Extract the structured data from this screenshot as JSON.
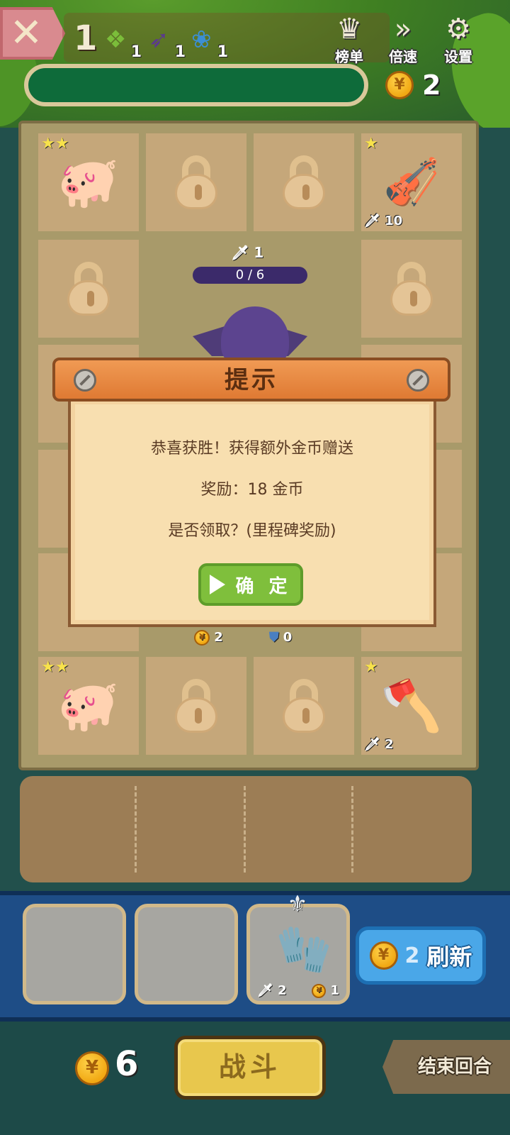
{
  "top_bar": {
    "close_label": "✕",
    "level": "1",
    "resources": [
      {
        "icon": "green-rune-icon",
        "glyph": "❖",
        "count": "1"
      },
      {
        "icon": "purple-wing-icon",
        "glyph": "➶",
        "count": "1"
      },
      {
        "icon": "blue-flower-icon",
        "glyph": "❀",
        "count": "1"
      }
    ],
    "buttons": [
      {
        "name": "leaderboard",
        "label": "榜单",
        "icon": "crown-icon",
        "glyph": "♛"
      },
      {
        "name": "speed",
        "label": "倍速",
        "icon": "fast-forward-icon",
        "glyph": "»"
      },
      {
        "name": "settings",
        "label": "设置",
        "icon": "gear-icon",
        "glyph": "⚙"
      }
    ],
    "coins": "2"
  },
  "board": {
    "cells": [
      {
        "icon": "piggy-bank-icon",
        "stars": "★★"
      },
      {
        "icon": "lock-icon"
      },
      {
        "icon": "lock-icon"
      },
      {
        "icon": "guzheng-icon",
        "stars": "★",
        "attack": "10"
      },
      {
        "icon": "lock-icon"
      },
      {
        "icon": "lock-icon"
      },
      {
        "icon": "piggy-bank-icon",
        "stars": "★★"
      },
      {
        "icon": "lock-icon"
      },
      {
        "icon": "lock-icon"
      },
      {
        "icon": "battle-axe-icon",
        "stars": "★",
        "attack": "2"
      }
    ],
    "enemy": {
      "attack": "1",
      "progress_text": "0 / 6",
      "gold": "2",
      "shield": "0"
    }
  },
  "modal": {
    "title": "提示",
    "line1": "恭喜获胜！获得额外金币赠送",
    "line2": "奖励：18 金币",
    "line3": "是否领取？(里程碑奖励)",
    "confirm_label": "确 定"
  },
  "shop": {
    "slots": [
      {
        "empty": true
      },
      {
        "empty": true
      },
      {
        "icon": "claw-gauntlet-icon",
        "attack": "2",
        "cost": "1",
        "badge_icon": "wolf-badge-icon"
      }
    ],
    "refresh_cost": "2",
    "refresh_label": "刷新"
  },
  "footer": {
    "gold": "6",
    "battle_label": "战斗",
    "end_turn_label": "结束回合"
  },
  "colors": {
    "board": "#a89a6a",
    "cell": "#c5a77a",
    "shop_bar": "#1e4d86",
    "refresh": "#4aa7e8",
    "confirm": "#7fbf3c",
    "battle": "#e8c74d"
  }
}
